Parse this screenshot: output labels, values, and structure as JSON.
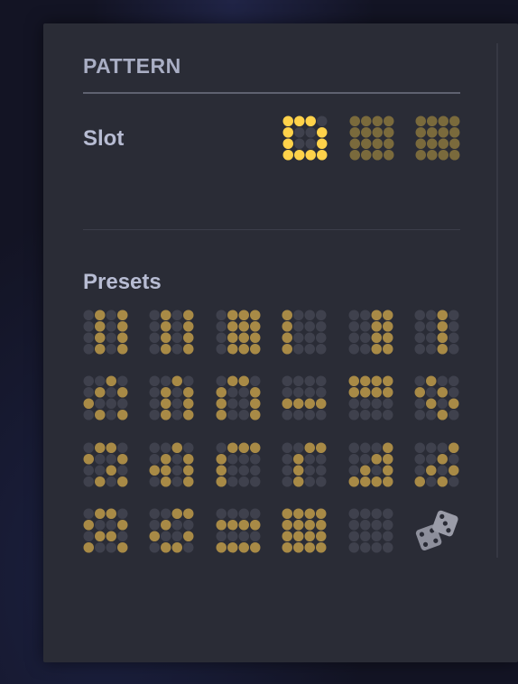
{
  "panel": {
    "title": "PATTERN"
  },
  "slot": {
    "label": "Slot",
    "patterns": [
      {
        "cells": [
          "1110",
          "1001",
          "1001",
          "1111"
        ],
        "color": "#ffd24a",
        "selected": true,
        "cells_row5": "0000"
      },
      {
        "cells": [
          "1111",
          "1111",
          "1111",
          "1111"
        ],
        "color": "#7a6a3c",
        "selected": false
      },
      {
        "cells": [
          "1111",
          "1111",
          "1111",
          "1111"
        ],
        "color": "#7a6a3c",
        "selected": false
      }
    ]
  },
  "presets": {
    "label": "Presets",
    "patterns": [
      [
        "01010",
        "01010",
        "01010",
        "01010",
        "01010"
      ],
      [
        "01010",
        "01010",
        "01010",
        "01010",
        "01010"
      ],
      [
        "01111",
        "01111",
        "01111",
        "01111",
        "01111"
      ],
      [
        "10000",
        "10000",
        "10000",
        "10000",
        "10000"
      ],
      [
        "00110",
        "00110",
        "00110",
        "00110",
        "00110"
      ],
      [
        "00100",
        "00100",
        "00100",
        "00100",
        "00100"
      ],
      [
        "00100",
        "01010",
        "10001",
        "01010",
        "00100"
      ],
      [
        "00100",
        "01010",
        "01010",
        "01010",
        "00100"
      ],
      [
        "01100",
        "10010",
        "10010",
        "10010",
        "01100"
      ],
      [
        "00000",
        "00000",
        "11111",
        "00000",
        "11111"
      ],
      [
        "11111",
        "11111",
        "00000",
        "00000",
        "00000"
      ],
      [
        "01000",
        "10100",
        "01010",
        "00101",
        "00010"
      ],
      [
        "01100",
        "10010",
        "00101",
        "01010",
        "10100"
      ],
      [
        "00100",
        "01010",
        "11011",
        "01010",
        "00100"
      ],
      [
        "01110",
        "10001",
        "10001",
        "10001",
        "01110"
      ],
      [
        "00110",
        "01001",
        "01001",
        "01001",
        "01110"
      ],
      [
        "00010",
        "00110",
        "01010",
        "11111",
        "00010"
      ],
      [
        "00010",
        "00101",
        "01010",
        "10100",
        "01000"
      ],
      [
        "01100",
        "10010",
        "01100",
        "10010",
        "11111"
      ],
      [
        "00110",
        "01001",
        "10010",
        "01100",
        "01000"
      ],
      [
        "00000",
        "11111",
        "00000",
        "11111",
        "00000"
      ],
      [
        "11111",
        "11111",
        "11111",
        "11111",
        "11111"
      ],
      [
        "00000",
        "00000",
        "00000",
        "00000",
        "00000"
      ]
    ],
    "dice_icon": "dice-icon",
    "active_color": "#a88a46",
    "inactive_color": "#3f414d"
  }
}
